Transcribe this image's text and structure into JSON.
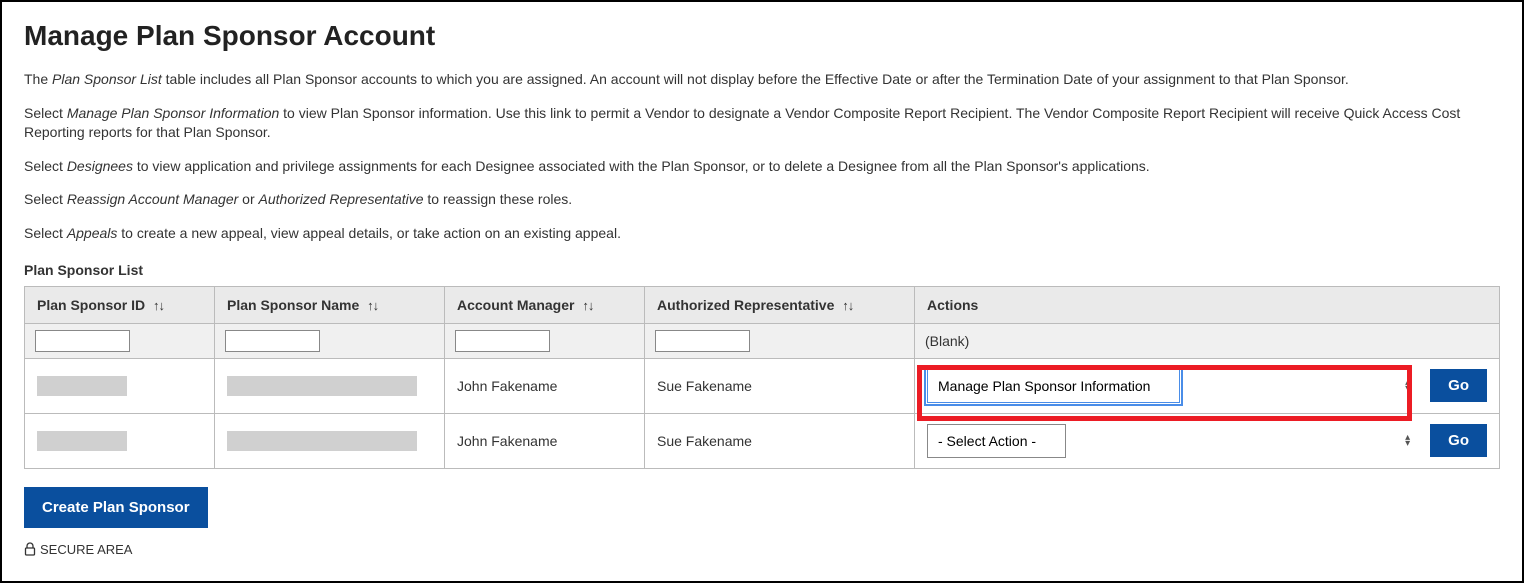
{
  "page": {
    "title": "Manage Plan Sponsor Account"
  },
  "intro": {
    "p1_a": "The ",
    "p1_em": "Plan Sponsor List",
    "p1_b": " table includes all Plan Sponsor accounts to which you are assigned. An account will not display before the Effective Date or after the Termination Date of your assignment to that Plan Sponsor.",
    "p2_a": "Select ",
    "p2_em": "Manage Plan Sponsor Information",
    "p2_b": " to view Plan Sponsor information. Use this link to permit a Vendor to designate a Vendor Composite Report Recipient. The Vendor Composite Report Recipient will receive Quick Access Cost Reporting reports for that Plan Sponsor.",
    "p3_a": "Select ",
    "p3_em": "Designees",
    "p3_b": " to view application and privilege assignments for each Designee associated with the Plan Sponsor, or to delete a Designee from all the Plan Sponsor's applications.",
    "p4_a": "Select ",
    "p4_em1": "Reassign Account Manager",
    "p4_mid": " or ",
    "p4_em2": "Authorized Representative",
    "p4_b": " to reassign these roles.",
    "p5_a": "Select ",
    "p5_em": "Appeals",
    "p5_b": " to create a new appeal, view appeal details, or take action on an existing appeal."
  },
  "table": {
    "caption": "Plan Sponsor List",
    "headers": {
      "sponsor_id": "Plan Sponsor ID",
      "sponsor_name": "Plan Sponsor Name",
      "account_manager": "Account Manager",
      "auth_rep": "Authorized Representative",
      "actions": "Actions"
    },
    "filter_actions_label": "(Blank)",
    "rows": [
      {
        "sponsor_id": "",
        "sponsor_name": "",
        "account_manager": "John Fakename",
        "auth_rep": "Sue Fakename",
        "action_selected": "Manage Plan Sponsor Information",
        "go_label": "Go",
        "highlighted": true
      },
      {
        "sponsor_id": "",
        "sponsor_name": "",
        "account_manager": "John Fakename",
        "auth_rep": "Sue Fakename",
        "action_selected": "- Select Action -",
        "go_label": "Go",
        "highlighted": false
      }
    ]
  },
  "buttons": {
    "create_sponsor": "Create Plan Sponsor"
  },
  "footer": {
    "secure_area": "SECURE AREA"
  }
}
